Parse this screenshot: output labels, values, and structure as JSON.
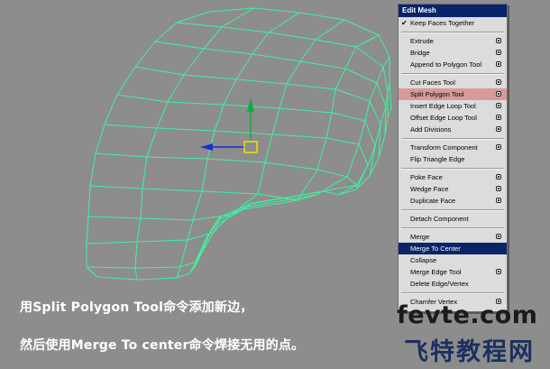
{
  "captions": {
    "line1": "用Split Polygon Tool命令添加新边，",
    "line2": "然后使用Merge To center命令焊接无用的点。"
  },
  "watermark": {
    "domain": "fevte.com",
    "site_name": "飞特教程网"
  },
  "colors": {
    "viewport_background": "#8d8d8d",
    "wireframe": "#3ff2a0",
    "menu_highlight": "#0a246a",
    "menu_hover": "#d99999",
    "manipulator_x": "#1f2bd6",
    "manipulator_y": "#17a845",
    "manipulator_center": "#f0e000"
  },
  "menu": {
    "title": "Edit Mesh",
    "items": [
      {
        "label": "Keep Faces Together",
        "checked": true,
        "option": false
      },
      {
        "separator": true
      },
      {
        "label": "Extrude",
        "option": true
      },
      {
        "label": "Bridge",
        "option": true
      },
      {
        "label": "Append to Polygon Tool",
        "option": true
      },
      {
        "separator": true
      },
      {
        "label": "Cut Faces Tool",
        "option": true
      },
      {
        "label": "Split Polygon Tool",
        "option": true,
        "state": "hover"
      },
      {
        "label": "Insert Edge Loop Tool",
        "option": true
      },
      {
        "label": "Offset Edge Loop Tool",
        "option": true
      },
      {
        "label": "Add Divisions",
        "option": true
      },
      {
        "separator": true
      },
      {
        "label": "Transform Component",
        "option": true
      },
      {
        "label": "Flip Triangle Edge",
        "option": false
      },
      {
        "separator": true
      },
      {
        "label": "Poke Face",
        "option": true
      },
      {
        "label": "Wedge Face",
        "option": true
      },
      {
        "label": "Duplicate Face",
        "option": true
      },
      {
        "separator": true
      },
      {
        "label": "Detach Component",
        "option": false
      },
      {
        "separator": true
      },
      {
        "label": "Merge",
        "option": true
      },
      {
        "label": "Merge To Center",
        "option": false,
        "state": "active"
      },
      {
        "label": "Collapse",
        "option": false
      },
      {
        "label": "Merge Edge Tool",
        "option": true
      },
      {
        "label": "Delete Edge/Vertex",
        "option": false
      },
      {
        "separator": true
      },
      {
        "label": "Chamfer Vertex",
        "option": true
      }
    ]
  }
}
